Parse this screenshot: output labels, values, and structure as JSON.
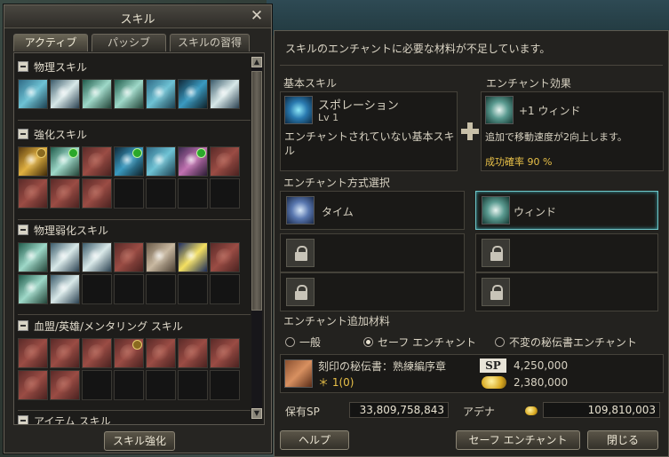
{
  "skill_window": {
    "title": "スキル",
    "tabs": [
      "アクティブ",
      "パッシブ",
      "スキルの習得"
    ],
    "sections": [
      {
        "title": "物理スキル"
      },
      {
        "title": "強化スキル"
      },
      {
        "title": "物理弱化スキル"
      },
      {
        "title": "血盟/英雄/メンタリング スキル"
      },
      {
        "title": "アイテム スキル"
      }
    ],
    "enhance_button": "スキル強化"
  },
  "enchant_window": {
    "message": "スキルのエンチャントに必要な材料が不足しています。",
    "base_skill": {
      "label": "基本スキル",
      "name": "スポレーション",
      "level": "Lv 1",
      "desc": "エンチャントされていない基本スキル"
    },
    "effect": {
      "label": "エンチャント効果",
      "name": "+1 ウィンド",
      "desc": "追加で移動速度が2向上します。",
      "rate": "成功確率 90 %"
    },
    "method": {
      "label": "エンチャント方式選択",
      "option_left": "タイム",
      "option_right": "ウィンド"
    },
    "materials": {
      "label": "エンチャント追加材料",
      "radios": [
        "一般",
        "セーフ エンチャント",
        "不変の秘伝書エンチャント"
      ],
      "item_name": "刻印の秘伝書：熟練編序章",
      "item_qty": "＊ 1(0)",
      "sp_tag": "SP",
      "sp_cost": "4,250,000",
      "adena_cost": "2,380,000"
    },
    "owned_sp_label": "保有SP",
    "owned_sp": "33,809,758,843",
    "adena_label": "アデナ",
    "adena": "109,810,003",
    "buttons": {
      "help": "ヘルプ",
      "safe_enchant": "セーフ エンチャント",
      "close": "閉じる"
    }
  }
}
